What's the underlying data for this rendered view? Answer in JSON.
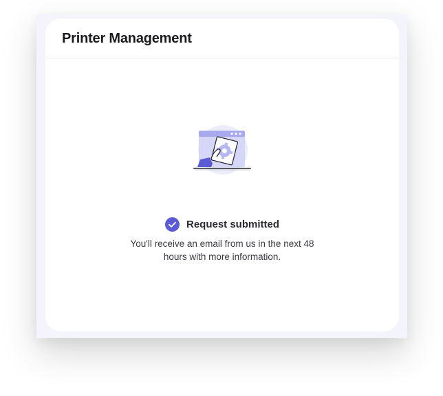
{
  "card": {
    "title": "Printer Management"
  },
  "status": {
    "title": "Request submitted",
    "message_line1": "You'll receive an email from us in the next 48",
    "message_line2": "hours with more information.",
    "icon": "check-circle-icon",
    "illustration": "settings-window-hand-illustration"
  },
  "colors": {
    "accent": "#5b5bd6",
    "accent_light": "#c9c9f6",
    "card_background": "#ffffff",
    "frame_background": "#f4f5fc",
    "title_text": "#1b1b1f",
    "body_text": "#3a3a44"
  }
}
